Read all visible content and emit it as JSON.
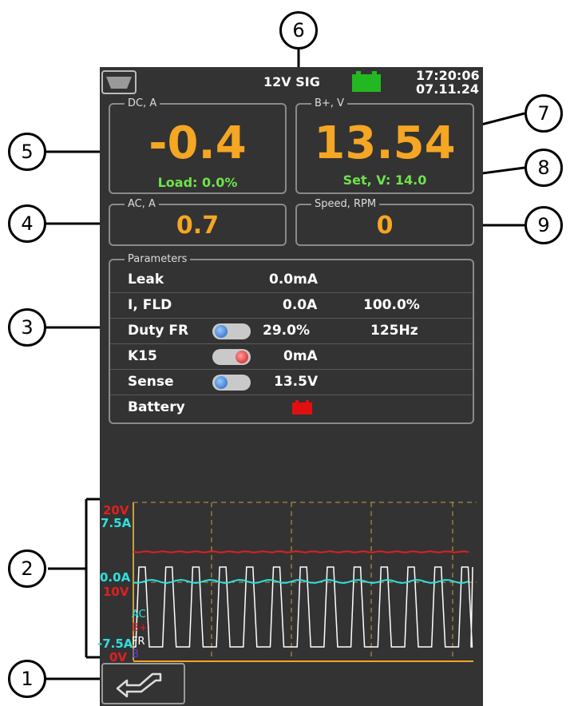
{
  "topbar": {
    "mode": "12V SIG",
    "time": "17:20:06",
    "date": "07.11.24"
  },
  "dc": {
    "title": "DC, A",
    "value": "-0.4",
    "load": "Load: 0.0%"
  },
  "bplus": {
    "title": "B+, V",
    "value": "13.54",
    "set": "Set, V: 14.0"
  },
  "ac": {
    "title": "AC, A",
    "value": "0.7"
  },
  "speed": {
    "title": "Speed, RPM",
    "value": "0"
  },
  "parameters": {
    "title": "Parameters",
    "rows": [
      {
        "name": "Leak",
        "value": "0.0mA",
        "extra": ""
      },
      {
        "name": "I, FLD",
        "value": "0.0A",
        "extra": "100.0%"
      },
      {
        "name": "Duty FR",
        "value": "29.0%",
        "extra": "125Hz",
        "toggle": "blue"
      },
      {
        "name": "K15",
        "value": "0mA",
        "extra": "",
        "toggle": "red"
      },
      {
        "name": "Sense",
        "value": "13.5V",
        "extra": "",
        "toggle": "blue"
      },
      {
        "name": "Battery",
        "value": "",
        "extra": "",
        "indicator": "red"
      }
    ]
  },
  "oscilloscope": {
    "axis": {
      "v_top": "20V",
      "a_top": "7.5A",
      "a_mid": "0.0A",
      "v_mid": "10V",
      "a_bottom": "-7.5A",
      "v_bottom": "0V"
    },
    "legend": {
      "ac": "AC",
      "bplus": "B+",
      "fr": "FR",
      "b": "B"
    },
    "colors": {
      "volt": "#e02020",
      "amp": "#2ee0e0",
      "fr": "#ffffff",
      "grid": "#c8a040"
    }
  },
  "colors": {
    "value_orange": "#f5a623",
    "value_green": "#6fe34a",
    "battery_green": "#22b822",
    "screen_bg": "#333333"
  },
  "icons": {
    "connector": "connector-icon",
    "battery": "battery-icon",
    "back": "back-arrow-icon"
  },
  "callouts": [
    "1",
    "2",
    "3",
    "4",
    "5",
    "6",
    "7",
    "8",
    "9"
  ]
}
